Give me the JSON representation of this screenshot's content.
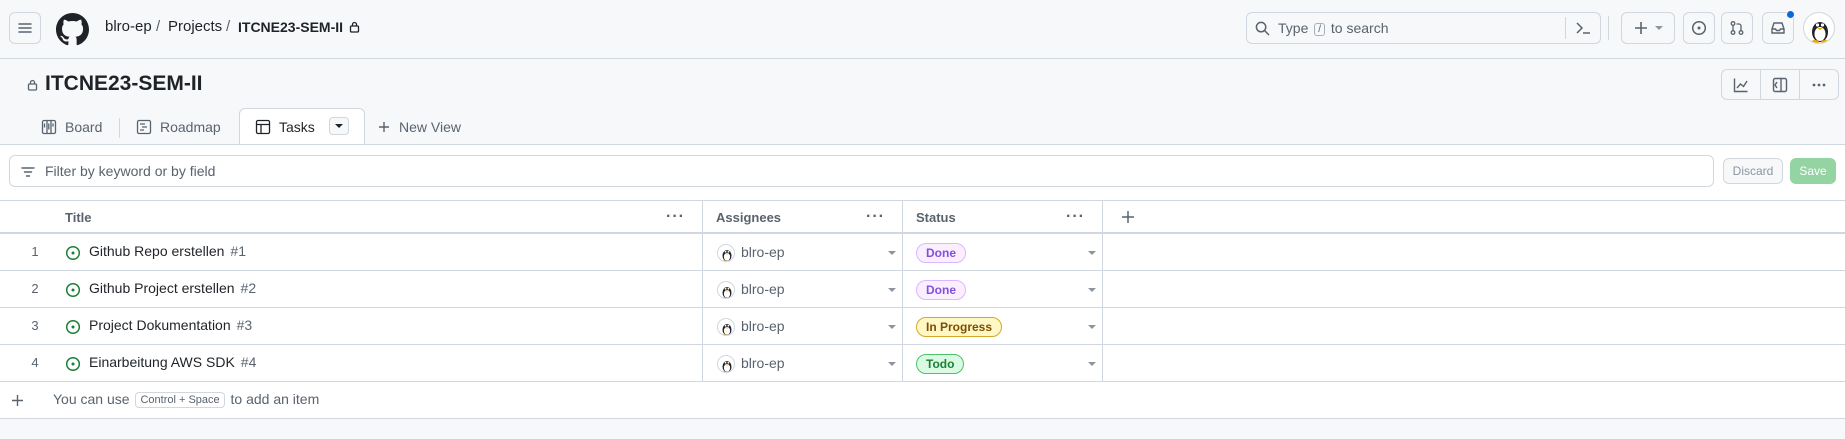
{
  "header": {
    "breadcrumb": {
      "owner": "blro-ep",
      "projects": "Projects",
      "project": "ITCNE23-SEM-II",
      "sep": "/"
    },
    "search": {
      "prefix": "Type",
      "key": "/",
      "suffix": "to search"
    },
    "notification_color": "#0969da"
  },
  "project": {
    "title": "ITCNE23-SEM-II",
    "tabs": [
      {
        "label": "Board",
        "icon": "board-icon"
      },
      {
        "label": "Roadmap",
        "icon": "roadmap-icon"
      },
      {
        "label": "Tasks",
        "icon": "table-icon",
        "active": true
      }
    ],
    "new_view": "New View"
  },
  "filter": {
    "placeholder": "Filter by keyword or by field",
    "discard": "Discard",
    "save": "Save"
  },
  "table": {
    "columns": {
      "title": "Title",
      "assignees": "Assignees",
      "status": "Status"
    },
    "rows": [
      {
        "num": "1",
        "title": "Github Repo erstellen",
        "issue": "#1",
        "assignee": "blro-ep",
        "status": "Done"
      },
      {
        "num": "2",
        "title": "Github Project erstellen",
        "issue": "#2",
        "assignee": "blro-ep",
        "status": "Done"
      },
      {
        "num": "3",
        "title": "Project Dokumentation",
        "issue": "#3",
        "assignee": "blro-ep",
        "status": "In Progress"
      },
      {
        "num": "4",
        "title": "Einarbeitung AWS SDK",
        "issue": "#4",
        "assignee": "blro-ep",
        "status": "Todo"
      }
    ],
    "add_item": {
      "prefix": "You can use",
      "shortcut": "Control + Space",
      "suffix": "to add an item"
    }
  },
  "status_colors": {
    "Done": {
      "bg": "#fbefff",
      "border": "#d8b9ff",
      "fg": "#8250df"
    },
    "In Progress": {
      "bg": "#fff8c5",
      "border": "#d4a72c",
      "fg": "#7d4e00"
    },
    "Todo": {
      "bg": "#dafbe1",
      "border": "#4ac26b",
      "fg": "#1a7f37"
    }
  }
}
